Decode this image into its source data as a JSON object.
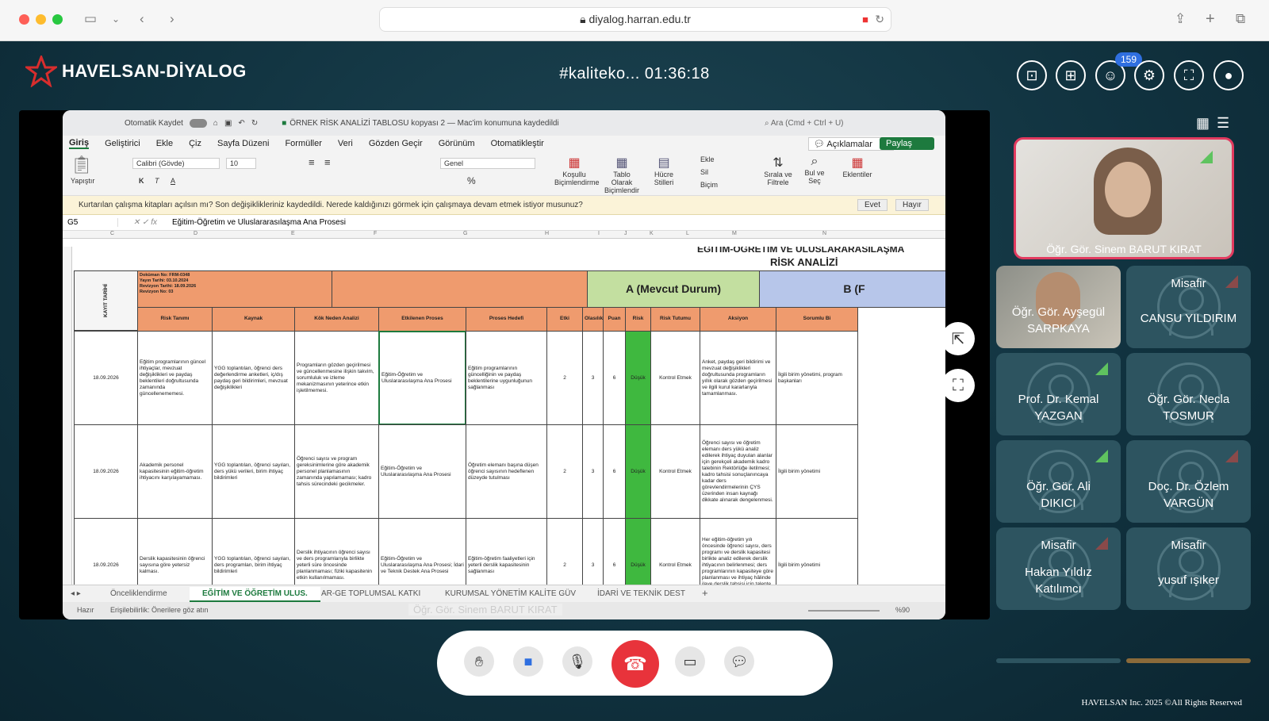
{
  "browser": {
    "url": "diyalog.harran.edu.tr"
  },
  "app": {
    "logo_text": "HAVELSAN-DİYALOG",
    "meeting_title": "#kaliteko... 01:36:18",
    "participant_count": "159"
  },
  "excel": {
    "autosave_label": "Otomatik Kaydet",
    "doc_title": "ÖRNEK RİSK ANALİZİ TABLOSU kopyası 2 — Mac'im konumuna kaydedildi",
    "search_placeholder": "Ara (Cmd + Ctrl + U)",
    "tabs": [
      "Giriş",
      "Geliştirici",
      "Ekle",
      "Çiz",
      "Sayfa Düzeni",
      "Formüller",
      "Veri",
      "Gözden Geçir",
      "Görünüm",
      "Otomatikleştir"
    ],
    "comments_label": "Açıklamalar",
    "share_label": "Paylaş",
    "font_name": "Calibri (Gövde)",
    "font_size": "10",
    "number_format": "Genel",
    "ribbon_labels": {
      "paste": "Yapıştır",
      "cond": "Koşullu Biçimlendirme",
      "table": "Tablo Olarak Biçimlendir",
      "cell": "Hücre Stilleri",
      "insert": "Ekle",
      "delete": "Sil",
      "format": "Biçim",
      "sort": "Sırala ve Filtrele",
      "find": "Bul ve Seç",
      "addins": "Eklentiler"
    },
    "msg": "Kurtarılan çalışma kitapları açılsın mı?  Son değişiklikleriniz kaydedildi. Nerede kaldığınızı görmek için çalışmaya devam etmek istiyor musunuz?",
    "msg_yes": "Evet",
    "msg_no": "Hayır",
    "cell_ref": "G5",
    "formula": "Eğitim-Öğretim ve Uluslararasılaşma Ana Prosesi",
    "col_letters": [
      "C",
      "D",
      "E",
      "F",
      "G",
      "H",
      "I",
      "J",
      "K",
      "L",
      "M",
      "N"
    ],
    "sheet_title_top": "EĞİTİM-ÖĞRETİM VE ULUSLARARASILAŞMA",
    "sheet_title": "RİSK ANALİZİ",
    "doc_meta": "Doküman No: FRM-0348\nYayın Tarihi: 03.10.2024\nRevizyon Tarihi: 18.09.2026\nRevizyon No: 03",
    "kayit_tarihi": "KAYIT TARİHİ",
    "section_a": "A (Mevcut Durum)",
    "section_b": "B (F",
    "headers": [
      "Risk Tanımı",
      "Kaynak",
      "Kök Neden Analizi",
      "Etkilenen Proses",
      "Proses Hedefi",
      "Etki",
      "Olasılık",
      "Puan",
      "Risk Derecesi",
      "Risk Tutumu",
      "Aksiyon",
      "Sorumlu Bi"
    ],
    "rows": [
      [
        "18.09.2026",
        "Eğitim programlarının güncel ihtiyaçlar, mevzuat değişiklikleri ve paydaş beklentileri doğrultusunda zamanında güncellenememesi.",
        "YGG toplantıları, öğrenci ders değerlendirme anketleri, iç/dış paydaş geri bildirimleri, mevzuat değişiklikleri",
        "Programların gözden geçirilmesi ve güncellenmesine ilişkin takvim, sorumluluk ve izleme mekanizmasının yeterince etkin işletilmemesi.",
        "Eğitim-Öğretim ve Uluslararasılaşma Ana Prosesi",
        "Eğitim programlarının güncelliğinin ve paydaş beklentilerine uygunluğunun sağlanması",
        "2",
        "3",
        "6",
        "Düşük",
        "Kontrol Etmek",
        "Anket, paydaş geri bildirimi ve mevzuat değişiklikleri doğrultusunda programların yıllık olarak gözden geçirilmesi ve ilgili kurul kararlarıyla tamamlanması.",
        "İlgili birim yönetimi, program başkanları"
      ],
      [
        "18.09.2026",
        "Akademik personel kapasitesinin eğitim-öğretim ihtiyacını karşılayamaması.",
        "YGG toplantıları, öğrenci sayıları, ders yükü verileri, birim ihtiyaç bildirimleri",
        "Öğrenci sayısı ve program gereksinimlerine göre akademik personel planlamasının zamanında yapılamaması; kadro tahsis sürecindeki gecikmeler.",
        "Eğitim-Öğretim ve Uluslararasılaşma Ana Prosesi",
        "Öğretim elemanı başına düşen öğrenci sayısının hedeflenen düzeyde tutulması",
        "2",
        "3",
        "6",
        "Düşük",
        "Kontrol Etmek",
        "Öğrenci sayısı ve öğretim elemanı ders yükü analiz edilerek ihtiyaç duyulan alanlar için gerekçeli akademik kadro talebinin Rektörlüğe iletilmesi; kadro tahsisi sonuçlanıncaya kadar ders görevlendirmelerinin ÇYS üzerinden insan kaynağı dikkate alınarak dengelenmesi.",
        "İlgili birim yönetimi"
      ],
      [
        "18.09.2026",
        "Derslik kapasitesinin öğrenci sayısına göre yetersiz kalması.",
        "YGG toplantıları, öğrenci sayıları, ders programları, birim ihtiyaç bildirimleri",
        "Derslik ihtiyacının öğrenci sayısı ve ders programlarıyla birlikte yeterli süre öncesinde planlanmaması; fiziki kapasitenin etkin kullanılmaması.",
        "Eğitim-Öğretim ve Uluslararasılaşma Ana Prosesi; İdari ve Teknik Destek Ana Prosesi",
        "Eğitim-öğretim faaliyetleri için yeterli derslik kapasitesinin sağlanması",
        "2",
        "3",
        "6",
        "Düşük",
        "Kontrol Etmek",
        "Her eğitim-öğretim yılı öncesinde öğrenci sayısı, ders programı ve derslik kapasitesi birlikte analiz edilerek derslik ihtiyacının belirlenmesi; ders programlarının kapasiteye göre planlanması ve ihtiyaç hâlinde ilave derslik tahsisi için talepte bulunulması.",
        "İlgili birim yönetimi"
      ]
    ],
    "sheet_tabs": [
      "Önceliklendirme",
      "EĞİTİM VE ÖĞRETİM ULUS.",
      "AR-GE TOPLUMSAL KATKI",
      "KURUMSAL YÖNETİM KALİTE GÜV",
      "İDARİ VE TEKNİK DEST"
    ],
    "status_ready": "Hazır",
    "status_access": "Erişilebilirlik: Önerilere göz atın",
    "zoom": "%90",
    "presenter_overlay": "Öğr. Gör. Sinem BARUT KIRAT"
  },
  "participants": {
    "featured": "Öğr. Gör. Sinem BARUT KIRAT",
    "tiles": [
      {
        "guest": "",
        "name": "Öğr. Gör. Ayşegül SARPKAYA",
        "signal": ""
      },
      {
        "guest": "Misafir",
        "name": "CANSU YILDIRIM",
        "signal": "red"
      },
      {
        "guest": "",
        "name": "Prof. Dr. Kemal YAZGAN",
        "signal": "green"
      },
      {
        "guest": "",
        "name": "Öğr. Gör. Necla TOSMUR",
        "signal": ""
      },
      {
        "guest": "",
        "name": "Öğr. Gör. Ali DIKICI",
        "signal": "green"
      },
      {
        "guest": "",
        "name": "Doç. Dr. Özlem VARGÜN",
        "signal": "red"
      },
      {
        "guest": "Misafir",
        "name": "Hakan Yıldız Katılımcı",
        "signal": "red"
      },
      {
        "guest": "Misafir",
        "name": "yusuf ışıker",
        "signal": ""
      }
    ]
  },
  "footer": {
    "copyright": "HAVELSAN Inc. 2025 ©All Rights Reserved"
  }
}
